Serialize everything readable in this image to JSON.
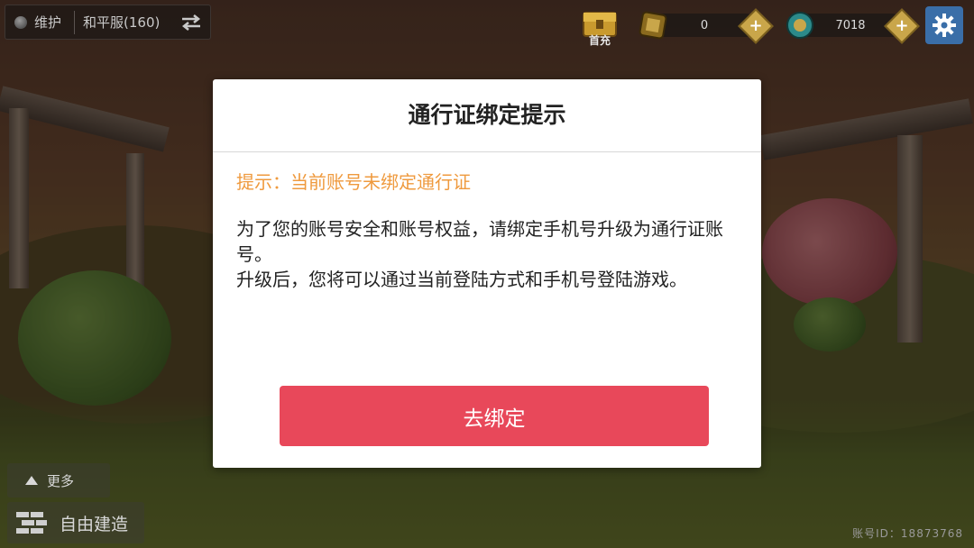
{
  "server": {
    "status": "维护",
    "name": "和平服(160)"
  },
  "currency": {
    "first_charge_label": "首充",
    "gold": "0",
    "coins": "7018"
  },
  "bottom": {
    "more_label": "更多",
    "build_label": "自由建造",
    "account_id": "账号ID：18873768"
  },
  "dialog": {
    "title": "通行证绑定提示",
    "hint": "提示：当前账号未绑定通行证",
    "body": [
      "为了您的账号安全和账号权益，请绑定手机号升级为通行证账号。",
      "升级后，您将可以通过当前登陆方式和手机号登陆游戏。"
    ],
    "bind_button": "去绑定"
  },
  "colors": {
    "accent_button": "#e8485a",
    "hint_text": "#ef9a3e",
    "settings_button": "#3a6ea8"
  },
  "icons": [
    "status-dot-icon",
    "swap-icon",
    "chest-icon",
    "gold-icon",
    "coin-icon",
    "plus-icon",
    "gear-icon",
    "triangle-up-icon",
    "bricks-icon"
  ]
}
